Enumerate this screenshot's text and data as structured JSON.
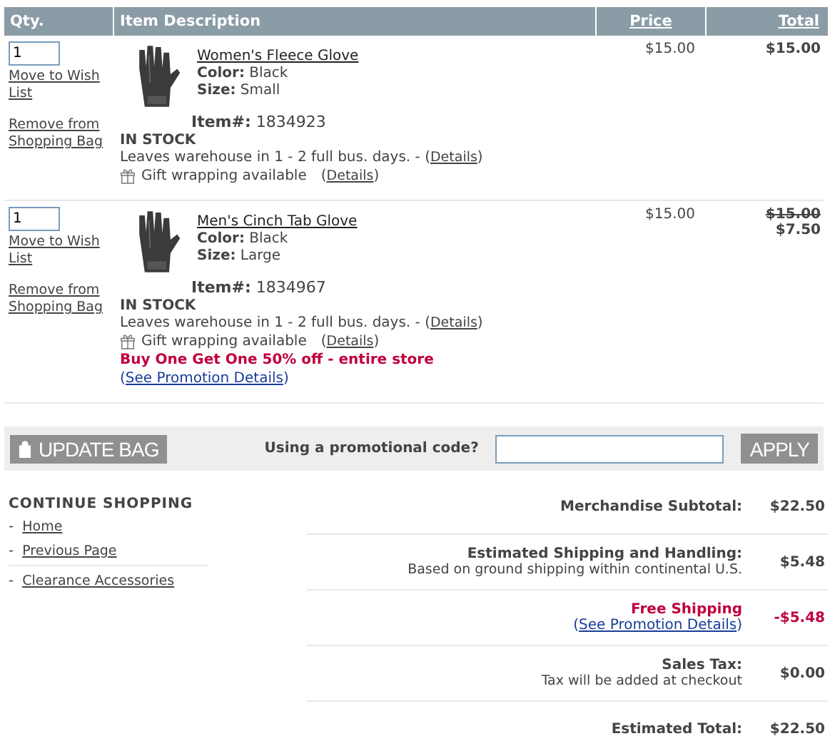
{
  "table": {
    "columns": [
      {
        "label": "Qty.",
        "link": false
      },
      {
        "label": "Item Description",
        "link": false
      },
      {
        "label": "Price",
        "link": true
      },
      {
        "label": "Total",
        "link": true
      }
    ],
    "rows": [
      {
        "qty": "1",
        "wish": "Move to Wish List",
        "remove": "Remove from Shopping Bag",
        "name": "Women's Fleece Glove",
        "color_label": "Color:",
        "color_value": "Black",
        "size_label": "Size:",
        "size": "Small",
        "item_label": "Item#:",
        "item": "1834923",
        "stock": "IN STOCK",
        "ship": "Leaves warehouse in 1 - 2 full bus. days. - (",
        "ship_link": "Details",
        "ship_close": ")",
        "gift": "Gift wrapping available",
        "gift_open": "(",
        "gift_link": "Details",
        "gift_close": ")",
        "price": "$15.00",
        "total": "$15.00"
      },
      {
        "qty": "1",
        "wish": "Move to Wish List",
        "remove": "Remove from Shopping Bag",
        "name": "Men's Cinch Tab Glove",
        "color_label": "Color:",
        "color_value": "Black",
        "size_label": "Size:",
        "size": "Large",
        "item_label": "Item#:",
        "item": "1834967",
        "stock": "IN STOCK",
        "ship": "Leaves warehouse in 1 - 2 full bus. days. - (",
        "ship_link": "Details",
        "ship_close": ")",
        "gift": "Gift wrapping available",
        "gift_open": "(",
        "gift_link": "Details",
        "gift_close": ")",
        "promo": "Buy One Get One 50% off - entire store",
        "promo_open": "(",
        "promo_link": "See Promotion Details",
        "promo_close": ")",
        "price": "$15.00",
        "total_old": "$15.00",
        "total": "$7.50"
      }
    ]
  },
  "promo_bar": {
    "update_button": "UPDATE BAG",
    "label": "Using a promotional code?",
    "apply_button": "APPLY"
  },
  "continue_shopping": {
    "title": "CONTINUE SHOPPING",
    "groups": [
      [
        {
          "dash": "-",
          "label": "Home"
        },
        {
          "dash": "-",
          "label": "Previous Page"
        }
      ],
      [
        {
          "dash": "-",
          "label": "Clearance Accessories"
        }
      ]
    ]
  },
  "summary": [
    {
      "kind": "normal",
      "label": "Merchandise Subtotal:",
      "value": "$22.50"
    },
    {
      "kind": "normal",
      "label": "Estimated Shipping and Handling:",
      "note": "Based on ground shipping within continental U.S.",
      "value": "$5.48"
    },
    {
      "kind": "promo",
      "label": "Free Shipping",
      "link_open": "(",
      "link": "See Promotion Details",
      "link_close": ")",
      "value": "-$5.48"
    },
    {
      "kind": "normal",
      "label": "Sales Tax:",
      "note": "Tax will be added at checkout",
      "value": "$0.00"
    },
    {
      "kind": "normal",
      "label": "Estimated Total:",
      "value": "$22.50"
    }
  ]
}
